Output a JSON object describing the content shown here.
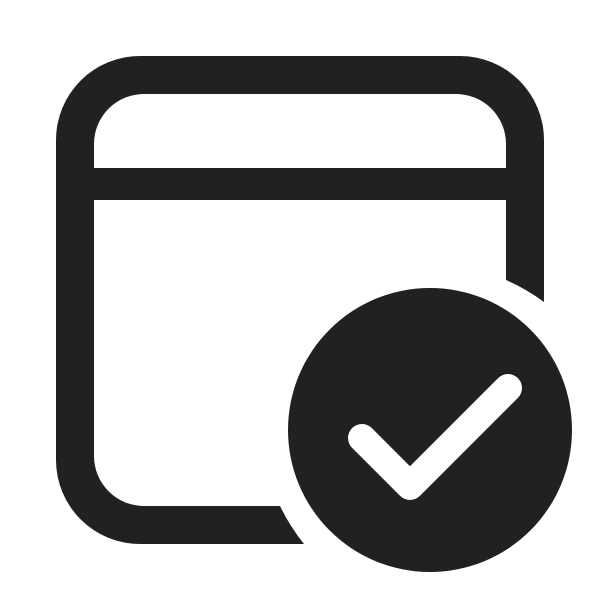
{
  "icon": {
    "name": "calendar-checkmark-icon",
    "color": "#212121",
    "background": "#ffffff",
    "badge_icon": "checkmark-icon",
    "badge_mark_color": "#ffffff"
  }
}
